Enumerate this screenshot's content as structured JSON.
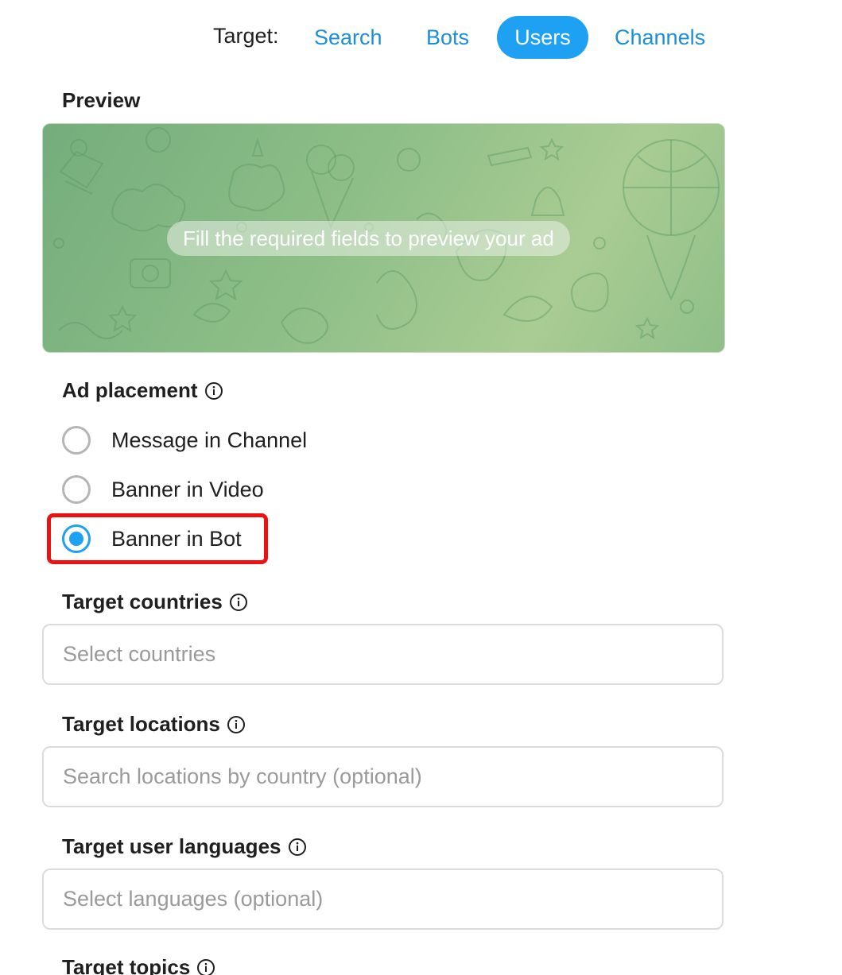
{
  "target": {
    "label": "Target:",
    "tabs": [
      {
        "label": "Search",
        "active": false
      },
      {
        "label": "Bots",
        "active": false
      },
      {
        "label": "Users",
        "active": true
      },
      {
        "label": "Channels",
        "active": false
      }
    ]
  },
  "preview": {
    "title": "Preview",
    "placeholder_text": "Fill the required fields to preview your ad"
  },
  "ad_placement": {
    "title": "Ad placement",
    "options": [
      {
        "label": "Message in Channel",
        "selected": false
      },
      {
        "label": "Banner in Video",
        "selected": false
      },
      {
        "label": "Banner in Bot",
        "selected": true
      }
    ]
  },
  "target_countries": {
    "title": "Target countries",
    "placeholder": "Select countries",
    "value": ""
  },
  "target_locations": {
    "title": "Target locations",
    "placeholder": "Search locations by country (optional)",
    "value": ""
  },
  "target_languages": {
    "title": "Target user languages",
    "placeholder": "Select languages (optional)",
    "value": ""
  },
  "target_topics": {
    "title": "Target topics"
  },
  "colors": {
    "accent": "#1ea1f2",
    "link": "#1c8fd8",
    "highlight": "#ee1111"
  },
  "icons": {
    "info": "info-circle-icon"
  }
}
